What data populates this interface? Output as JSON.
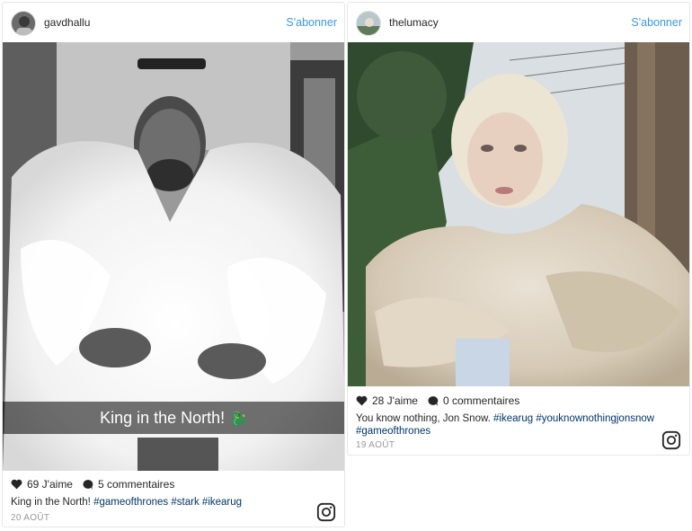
{
  "posts": [
    {
      "username": "gavdhallu",
      "follow_label": "S'abonner",
      "overlay_text": "King in the North!",
      "overlay_icon": "dragon-sticker-icon",
      "likes": "69 J'aime",
      "comments": "5 commentaires",
      "caption_text": "King in the North! ",
      "hashtags": [
        "#gameofthrones",
        "#stark",
        "#ikearug"
      ],
      "date": "20 AOÛT"
    },
    {
      "username": "thelumacy",
      "follow_label": "S'abonner",
      "likes": "28 J'aime",
      "comments": "0 commentaires",
      "caption_text": "You know nothing, Jon Snow. ",
      "hashtags": [
        "#ikearug",
        "#youknownothingjonsnow",
        "#gameofthrones"
      ],
      "date": "19 AOÛT"
    }
  ],
  "colors": {
    "follow": "#3897f0",
    "hashtag": "#003569",
    "date": "#999999",
    "border": "#e6e6e6"
  },
  "icons": [
    "heart-icon",
    "comment-icon",
    "instagram-logo-icon"
  ]
}
